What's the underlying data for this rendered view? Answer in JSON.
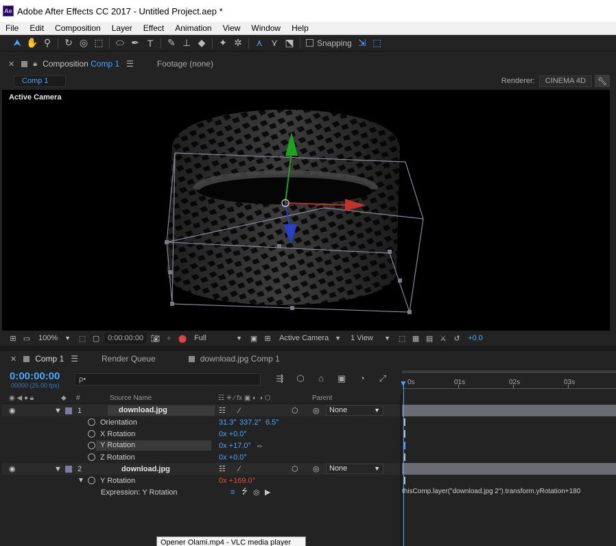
{
  "window": {
    "title": "Adobe After Effects CC 2017 - Untitled Project.aep *",
    "logo": "Ae"
  },
  "menu": [
    "File",
    "Edit",
    "Composition",
    "Layer",
    "Effect",
    "Animation",
    "View",
    "Window",
    "Help"
  ],
  "toolbar": {
    "snapping_label": "Snapping"
  },
  "comp_panel": {
    "tab_prefix": "Composition",
    "tab_comp": "Comp 1",
    "footage_tab": "Footage (none)",
    "comp_chip": "Comp 1",
    "renderer_label": "Renderer:",
    "renderer_value": "CINEMA 4D",
    "viewport_label": "Active Camera"
  },
  "viewer_footer": {
    "zoom": "100%",
    "timecode": "0:00:00:00",
    "resolution": "Full",
    "camera": "Active Camera",
    "views": "1 View",
    "exposure": "+0.0"
  },
  "timeline": {
    "tabs": [
      "Comp 1",
      "Render Queue",
      "download.jpg Comp 1"
    ],
    "timecode": "0:00:00:00",
    "fps": "00000 (25.00 fps)",
    "search_placeholder": "ρ•",
    "ruler_labels": [
      "0s",
      "01s",
      "02s",
      "03s"
    ],
    "columns": {
      "number": "#",
      "source_name": "Source Name",
      "parent": "Parent"
    },
    "layers": [
      {
        "number": "1",
        "name": "download.jpg",
        "parent": "None",
        "properties": [
          {
            "name": "Orientation",
            "value_a": "31.3°",
            "value_b": "337.2°",
            "value_c": "6.5°"
          },
          {
            "name": "X Rotation",
            "value": "0x +0.0°"
          },
          {
            "name": "Y Rotation",
            "value": "0x +17.0°"
          },
          {
            "name": "Z Rotation",
            "value": "0x +0.0°"
          }
        ]
      },
      {
        "number": "2",
        "name": "download.jpg",
        "parent": "None",
        "properties": [
          {
            "name": "Y Rotation",
            "value": "0x +169.0°"
          }
        ],
        "expression_label": "Expression: Y Rotation",
        "expression": "thisComp.layer(\"download.jpg 2\").transform.yRotation+180"
      }
    ]
  },
  "tooltip": "Opener Olami.mp4 - VLC media player",
  "colors": {
    "accent": "#4aa6ff",
    "expression_value": "#e0503a",
    "tire": "#2e2e2e"
  }
}
